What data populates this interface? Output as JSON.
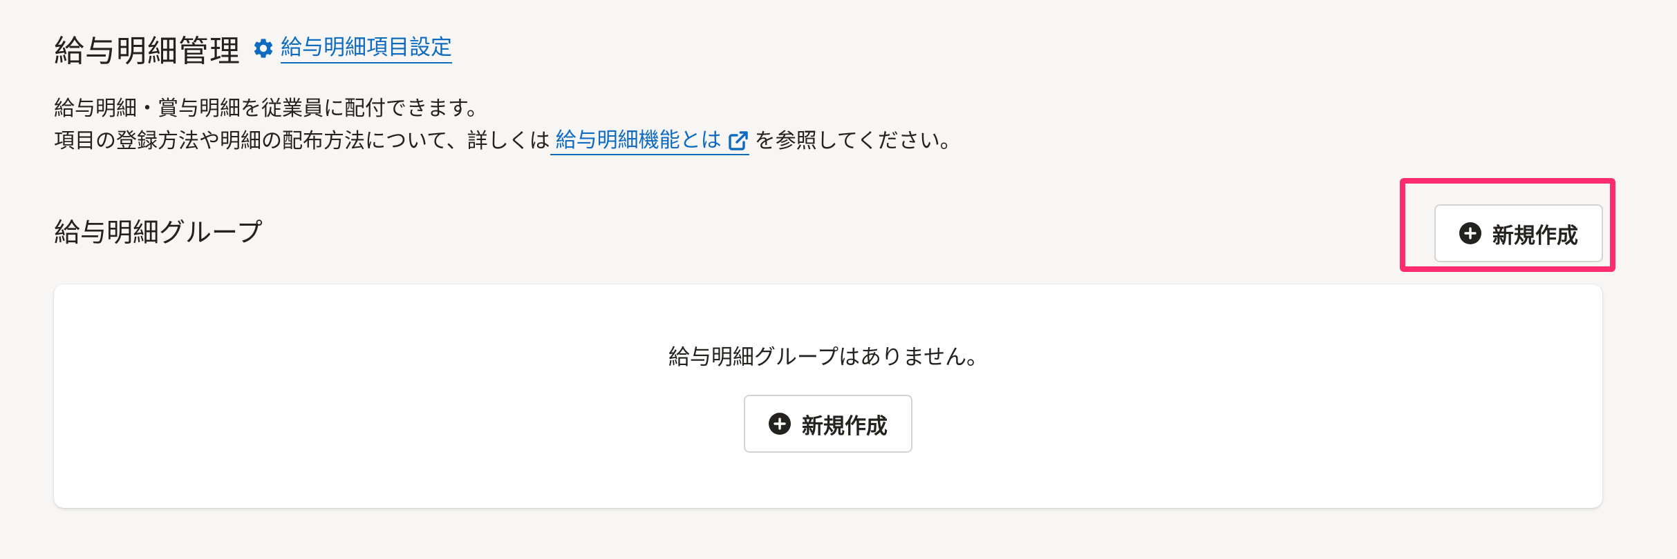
{
  "header": {
    "title": "給与明細管理",
    "settings_link": "給与明細項目設定"
  },
  "description": {
    "line1": "給与明細・賞与明細を従業員に配付できます。",
    "line2_before": "項目の登録方法や明細の配布方法について、詳しくは",
    "line2_link": "給与明細機能とは",
    "line2_after": "を参照してください。"
  },
  "section": {
    "title": "給与明細グループ",
    "new_button_label": "新規作成"
  },
  "empty_state": {
    "message": "給与明細グループはありません。",
    "new_button_label": "新規作成"
  },
  "icons": {
    "settings": "gear-icon",
    "external": "external-link-icon",
    "add": "plus-circle-icon"
  },
  "colors": {
    "link": "#0f6bbf",
    "highlight": "#ff2d6f",
    "background": "#f7f6f4",
    "text": "#23221f"
  }
}
